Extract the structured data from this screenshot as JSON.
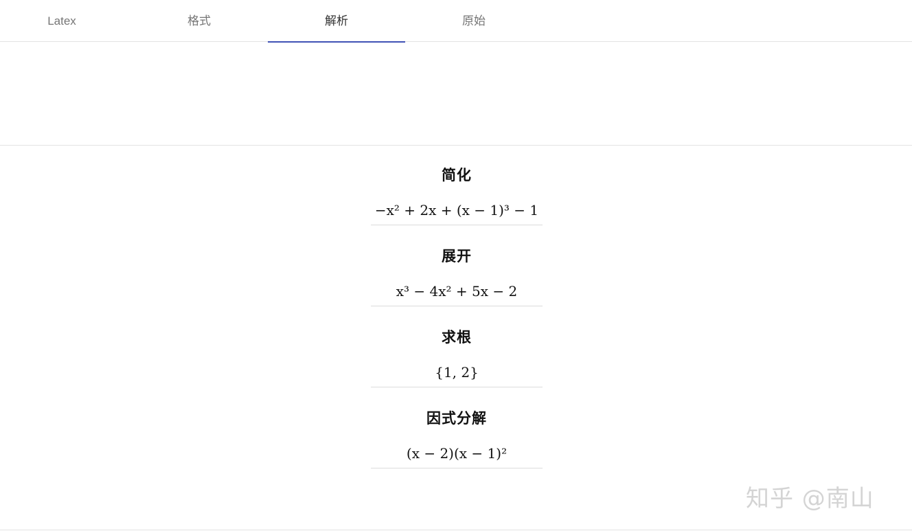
{
  "tabs": [
    {
      "label": "Latex"
    },
    {
      "label": "格式"
    },
    {
      "label": "解析",
      "active": true
    },
    {
      "label": "原始"
    }
  ],
  "colors": {
    "active_tab_indicator": "#3f51b5",
    "inactive_tab_text": "#757575",
    "divider": "#e3e3e3"
  },
  "results": [
    {
      "title": "简化",
      "formula": "−x² + 2x + (x − 1)³ − 1"
    },
    {
      "title": "展开",
      "formula": "x³ − 4x² + 5x − 2"
    },
    {
      "title": "求根",
      "formula": "{1, 2}"
    },
    {
      "title": "因式分解",
      "formula": "(x − 2)(x − 1)²"
    }
  ],
  "watermark": "知乎 @南山"
}
